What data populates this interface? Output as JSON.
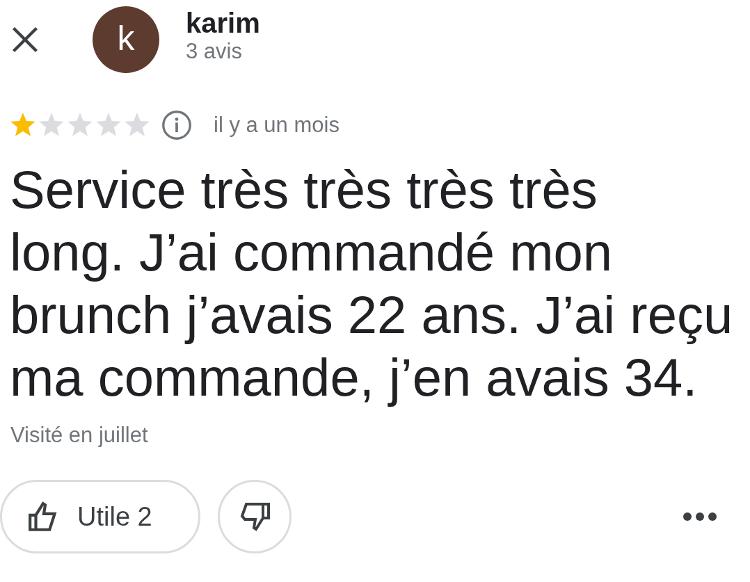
{
  "reviewer": {
    "initial": "k",
    "name": "karim",
    "review_count": "3 avis"
  },
  "review": {
    "stars": 1,
    "time": "il y a un mois",
    "text_lines": [
      "Service très très très très",
      "long. J’ai commandé mon",
      "brunch j’avais 22 ans. J’ai reçu",
      "ma commande, j’en avais 34."
    ],
    "visit": "Visité en juillet"
  },
  "actions": {
    "helpful": "Utile 2"
  }
}
